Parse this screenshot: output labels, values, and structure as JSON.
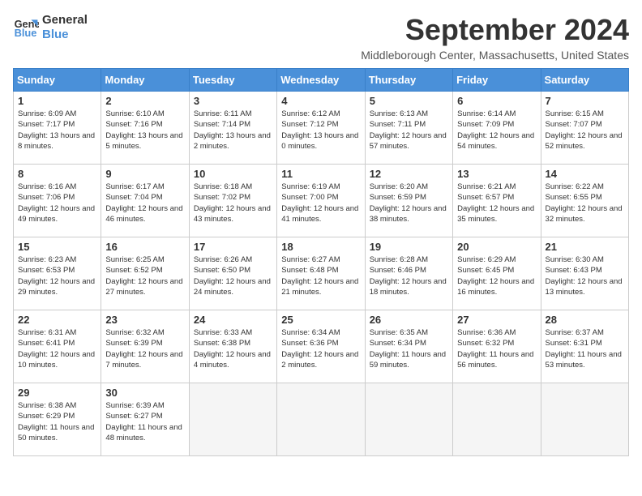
{
  "logo": {
    "line1": "General",
    "line2": "Blue"
  },
  "title": "September 2024",
  "location": "Middleborough Center, Massachusetts, United States",
  "days_of_week": [
    "Sunday",
    "Monday",
    "Tuesday",
    "Wednesday",
    "Thursday",
    "Friday",
    "Saturday"
  ],
  "weeks": [
    [
      {
        "day": "1",
        "sunrise": "6:09 AM",
        "sunset": "7:17 PM",
        "daylight": "13 hours and 8 minutes."
      },
      {
        "day": "2",
        "sunrise": "6:10 AM",
        "sunset": "7:16 PM",
        "daylight": "13 hours and 5 minutes."
      },
      {
        "day": "3",
        "sunrise": "6:11 AM",
        "sunset": "7:14 PM",
        "daylight": "13 hours and 2 minutes."
      },
      {
        "day": "4",
        "sunrise": "6:12 AM",
        "sunset": "7:12 PM",
        "daylight": "13 hours and 0 minutes."
      },
      {
        "day": "5",
        "sunrise": "6:13 AM",
        "sunset": "7:11 PM",
        "daylight": "12 hours and 57 minutes."
      },
      {
        "day": "6",
        "sunrise": "6:14 AM",
        "sunset": "7:09 PM",
        "daylight": "12 hours and 54 minutes."
      },
      {
        "day": "7",
        "sunrise": "6:15 AM",
        "sunset": "7:07 PM",
        "daylight": "12 hours and 52 minutes."
      }
    ],
    [
      {
        "day": "8",
        "sunrise": "6:16 AM",
        "sunset": "7:06 PM",
        "daylight": "12 hours and 49 minutes."
      },
      {
        "day": "9",
        "sunrise": "6:17 AM",
        "sunset": "7:04 PM",
        "daylight": "12 hours and 46 minutes."
      },
      {
        "day": "10",
        "sunrise": "6:18 AM",
        "sunset": "7:02 PM",
        "daylight": "12 hours and 43 minutes."
      },
      {
        "day": "11",
        "sunrise": "6:19 AM",
        "sunset": "7:00 PM",
        "daylight": "12 hours and 41 minutes."
      },
      {
        "day": "12",
        "sunrise": "6:20 AM",
        "sunset": "6:59 PM",
        "daylight": "12 hours and 38 minutes."
      },
      {
        "day": "13",
        "sunrise": "6:21 AM",
        "sunset": "6:57 PM",
        "daylight": "12 hours and 35 minutes."
      },
      {
        "day": "14",
        "sunrise": "6:22 AM",
        "sunset": "6:55 PM",
        "daylight": "12 hours and 32 minutes."
      }
    ],
    [
      {
        "day": "15",
        "sunrise": "6:23 AM",
        "sunset": "6:53 PM",
        "daylight": "12 hours and 29 minutes."
      },
      {
        "day": "16",
        "sunrise": "6:25 AM",
        "sunset": "6:52 PM",
        "daylight": "12 hours and 27 minutes."
      },
      {
        "day": "17",
        "sunrise": "6:26 AM",
        "sunset": "6:50 PM",
        "daylight": "12 hours and 24 minutes."
      },
      {
        "day": "18",
        "sunrise": "6:27 AM",
        "sunset": "6:48 PM",
        "daylight": "12 hours and 21 minutes."
      },
      {
        "day": "19",
        "sunrise": "6:28 AM",
        "sunset": "6:46 PM",
        "daylight": "12 hours and 18 minutes."
      },
      {
        "day": "20",
        "sunrise": "6:29 AM",
        "sunset": "6:45 PM",
        "daylight": "12 hours and 16 minutes."
      },
      {
        "day": "21",
        "sunrise": "6:30 AM",
        "sunset": "6:43 PM",
        "daylight": "12 hours and 13 minutes."
      }
    ],
    [
      {
        "day": "22",
        "sunrise": "6:31 AM",
        "sunset": "6:41 PM",
        "daylight": "12 hours and 10 minutes."
      },
      {
        "day": "23",
        "sunrise": "6:32 AM",
        "sunset": "6:39 PM",
        "daylight": "12 hours and 7 minutes."
      },
      {
        "day": "24",
        "sunrise": "6:33 AM",
        "sunset": "6:38 PM",
        "daylight": "12 hours and 4 minutes."
      },
      {
        "day": "25",
        "sunrise": "6:34 AM",
        "sunset": "6:36 PM",
        "daylight": "12 hours and 2 minutes."
      },
      {
        "day": "26",
        "sunrise": "6:35 AM",
        "sunset": "6:34 PM",
        "daylight": "11 hours and 59 minutes."
      },
      {
        "day": "27",
        "sunrise": "6:36 AM",
        "sunset": "6:32 PM",
        "daylight": "11 hours and 56 minutes."
      },
      {
        "day": "28",
        "sunrise": "6:37 AM",
        "sunset": "6:31 PM",
        "daylight": "11 hours and 53 minutes."
      }
    ],
    [
      {
        "day": "29",
        "sunrise": "6:38 AM",
        "sunset": "6:29 PM",
        "daylight": "11 hours and 50 minutes."
      },
      {
        "day": "30",
        "sunrise": "6:39 AM",
        "sunset": "6:27 PM",
        "daylight": "11 hours and 48 minutes."
      },
      null,
      null,
      null,
      null,
      null
    ]
  ]
}
